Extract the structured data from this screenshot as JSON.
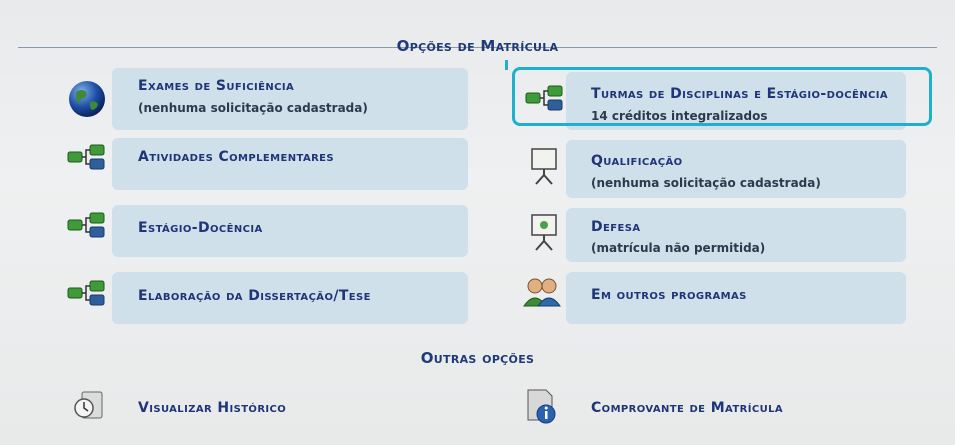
{
  "sections": {
    "enrollment": "Opções de Matrícula",
    "other": "Outras opções"
  },
  "options": [
    {
      "title": "Exames de Suficiência",
      "subtitle": "(nenhuma solicitação cadastrada)",
      "icon": "globe-icon"
    },
    {
      "title": "Turmas de Disciplinas e Estágio-docência",
      "subtitle": "14 créditos integralizados",
      "icon": "network-icon"
    },
    {
      "title": "Atividades Complementares",
      "subtitle": "",
      "icon": "network-icon"
    },
    {
      "title": "Qualificação",
      "subtitle": "(nenhuma solicitação cadastrada)",
      "icon": "presentation-board-icon"
    },
    {
      "title": "Estágio-Docência",
      "subtitle": "",
      "icon": "network-icon"
    },
    {
      "title": "Defesa",
      "subtitle": "(matrícula não permitida)",
      "icon": "presentation-board-icon"
    },
    {
      "title": "Elaboração da Dissertação/Tese",
      "subtitle": "",
      "icon": "network-icon"
    },
    {
      "title": "Em outros programas",
      "subtitle": "",
      "icon": "users-icon"
    }
  ],
  "other_options": [
    {
      "title": "Visualizar Histórico",
      "icon": "history-icon"
    },
    {
      "title": "Comprovante de Matrícula",
      "icon": "document-info-icon"
    }
  ],
  "colors": {
    "title": "#1f3577",
    "card": "#cfe0ea",
    "highlight": "#1fb0d0"
  }
}
